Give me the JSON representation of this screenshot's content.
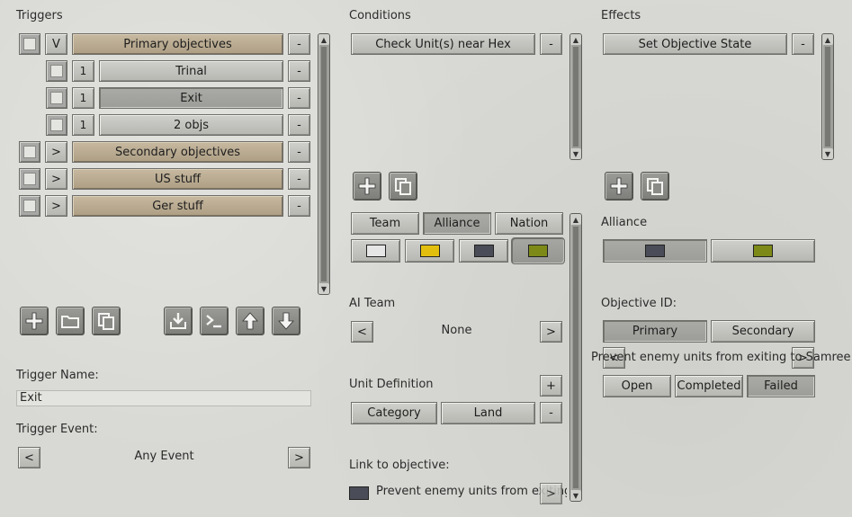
{
  "triggers": {
    "title": "Triggers",
    "rows": [
      {
        "expand": "V",
        "label": "Primary objectives",
        "tone": "tan",
        "remove": "-"
      },
      {
        "num": "1",
        "label": "Trinal",
        "tone": "grey",
        "remove": "-"
      },
      {
        "num": "1",
        "label": "Exit",
        "tone": "selected",
        "remove": "-"
      },
      {
        "num": "1",
        "label": "2 objs",
        "tone": "grey",
        "remove": "-"
      },
      {
        "expand": ">",
        "label": "Secondary objectives",
        "tone": "tan",
        "remove": "-"
      },
      {
        "expand": ">",
        "label": "US stuff",
        "tone": "tan",
        "remove": "-"
      },
      {
        "expand": ">",
        "label": "Ger stuff",
        "tone": "tan",
        "remove": "-"
      }
    ],
    "toolbar_icons": [
      "add-icon",
      "folder-icon",
      "copy-icon",
      "import-icon",
      "console-icon",
      "arrow-up-icon",
      "arrow-down-icon"
    ],
    "name_label": "Trigger Name:",
    "name_value": "Exit",
    "event_label": "Trigger Event:",
    "event_prev": "<",
    "event_value": "Any Event",
    "event_next": ">"
  },
  "conditions": {
    "title": "Conditions",
    "items": [
      {
        "label": "Check Unit(s) near Hex",
        "remove": "-"
      }
    ],
    "toolbar_icons": [
      "add-icon",
      "copy-icon"
    ],
    "tabs": [
      "Team",
      "Alliance",
      "Nation"
    ],
    "active_tab": "Alliance",
    "colors": [
      "#e6e6e6",
      "#e2bf0e",
      "#4a4d57",
      "#7e8a18"
    ],
    "ai_team_label": "AI Team",
    "ai_prev": "<",
    "ai_value": "None",
    "ai_next": ">",
    "unit_def_label": "Unit Definition",
    "unit_def_add": "+",
    "unit_def_category": "Category",
    "unit_def_value": "Land",
    "unit_def_remove": "-",
    "link_label": "Link to objective:",
    "link_text": "Prevent enemy units from exiting to",
    "link_color": "#4a4d57",
    "link_next": ">"
  },
  "effects": {
    "title": "Effects",
    "items": [
      {
        "label": "Set Objective State",
        "remove": "-"
      }
    ],
    "toolbar_icons": [
      "add-icon",
      "copy-icon"
    ],
    "alliance_label": "Alliance",
    "alliance_colors": [
      "#4a4d57",
      "#7e8a18"
    ],
    "objective_label": "Objective ID:",
    "objective_types": [
      "Primary",
      "Secondary"
    ],
    "objective_prev": "<",
    "objective_next": ">",
    "objective_text": "Prevent enemy units from exiting to Samree",
    "states": [
      "Open",
      "Completed",
      "Failed"
    ],
    "active_state": "Failed"
  }
}
